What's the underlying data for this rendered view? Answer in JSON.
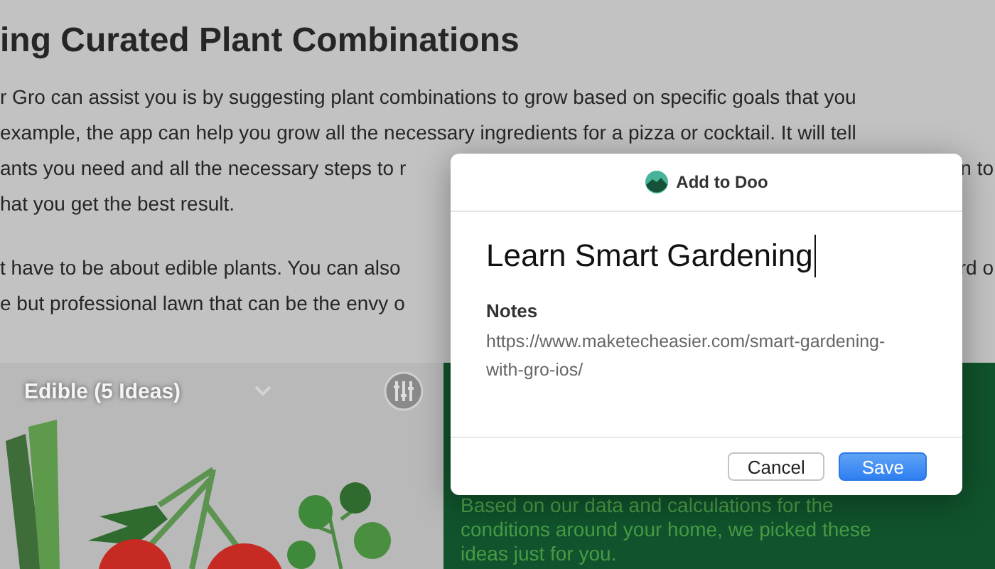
{
  "article": {
    "heading": "ing Curated Plant Combinations",
    "paragraphs": [
      {
        "lines": [
          {
            "text": "r Gro can assist you is by suggesting plant combinations to grow based on specific goals that you"
          },
          {
            "text": "example, the app can help you grow all the necessary ingredients for a pizza or cocktail. It will tell"
          },
          {
            "text": "ants you need and all the necessary steps to r",
            "right": "n to"
          },
          {
            "text": "hat you get the best result."
          }
        ]
      },
      {
        "lines": [
          {
            "text": "t have to be about edible plants. You can also",
            "right": "rd o"
          },
          {
            "text": "e but professional lawn that can be the envy o"
          }
        ]
      }
    ]
  },
  "plant_card": {
    "filter": {
      "label": "Edible (5 Ideas)"
    },
    "description": "Based on our data and calculations for the conditions around your home, we picked these ideas just for you."
  },
  "dialog": {
    "title": "Add to Doo",
    "task_title": "Learn Smart Gardening",
    "notes_label": "Notes",
    "notes": "https://www.maketecheasier.com/smart-gardening-with-gro-ios/",
    "buttons": [
      {
        "label": "Cancel",
        "kind": "secondary"
      },
      {
        "label": "Save",
        "kind": "primary"
      }
    ]
  }
}
